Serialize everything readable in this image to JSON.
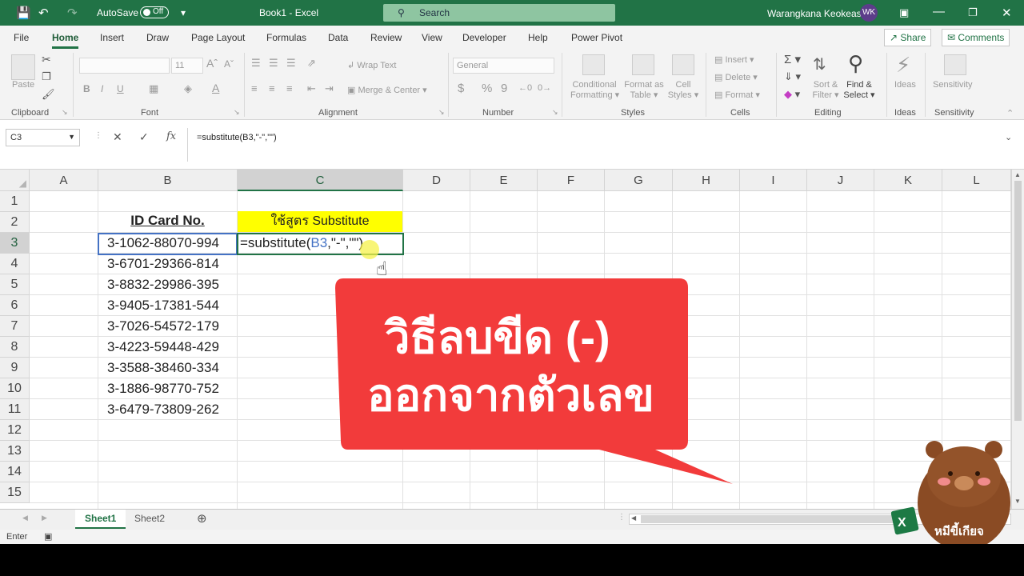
{
  "titlebar": {
    "autosave_label": "AutoSave",
    "autosave_state": "Off",
    "doc_title": "Book1 - Excel",
    "search_placeholder": "Search",
    "user_name": "Warangkana Keokeas",
    "user_initials": "WK"
  },
  "tabs": [
    "File",
    "Home",
    "Insert",
    "Draw",
    "Page Layout",
    "Formulas",
    "Data",
    "Review",
    "View",
    "Developer",
    "Help",
    "Power Pivot"
  ],
  "share_label": "Share",
  "comments_label": "Comments",
  "ribbon": {
    "clipboard": {
      "label": "Clipboard",
      "paste": "Paste"
    },
    "font": {
      "label": "Font",
      "size": "11",
      "bold": "B",
      "italic": "I",
      "underline": "U"
    },
    "alignment": {
      "label": "Alignment",
      "wrap_text": "Wrap Text",
      "merge_center": "Merge & Center"
    },
    "number": {
      "label": "Number",
      "format": "General",
      "currency": "$",
      "percent": "%",
      "comma": "9"
    },
    "styles": {
      "label": "Styles",
      "cond_fmt_1": "Conditional",
      "cond_fmt_2": "Formatting",
      "format_table_1": "Format as",
      "format_table_2": "Table",
      "cell_styles_1": "Cell",
      "cell_styles_2": "Styles"
    },
    "cells": {
      "label": "Cells",
      "insert": "Insert",
      "delete": "Delete",
      "format": "Format"
    },
    "editing": {
      "label": "Editing",
      "sort_1": "Sort &",
      "sort_2": "Filter",
      "find_1": "Find &",
      "find_2": "Select"
    },
    "ideas": {
      "label": "Ideas",
      "btn": "Ideas"
    },
    "sensitivity": {
      "label": "Sensitivity",
      "btn": "Sensitivity"
    }
  },
  "formula_bar": {
    "name_box": "C3",
    "formula": "=substitute(B3,\"-\",\"\")",
    "fx": "fx"
  },
  "grid": {
    "columns": [
      "A",
      "B",
      "C",
      "D",
      "E",
      "F",
      "G",
      "H",
      "I",
      "J",
      "K",
      "L"
    ],
    "rows": [
      "1",
      "2",
      "3",
      "4",
      "5",
      "6",
      "7",
      "8",
      "9",
      "10",
      "11",
      "12",
      "13",
      "14",
      "15"
    ],
    "b2_header": "ID Card No.",
    "c2_header": "ใช้สูตร Substitute",
    "id_values": [
      "3-1062-88070-994",
      "3-6701-29366-814",
      "3-8832-29986-395",
      "3-9405-17381-544",
      "3-7026-54572-179",
      "3-4223-59448-429",
      "3-3588-38460-334",
      "3-1886-98770-752",
      "3-6479-73809-262"
    ],
    "c3_formula_part1": "=substitute(",
    "c3_formula_ref": "B3",
    "c3_formula_part2": ",\"-\",\"\")"
  },
  "sheets": [
    "Sheet1",
    "Sheet2"
  ],
  "status": {
    "mode": "Enter"
  },
  "overlay": {
    "line1": "วิธีลบขีด (-)",
    "line2": "ออกจากตัวเลข",
    "bubble_color": "#f23b3b"
  },
  "mascot": {
    "label": "หมีขี้เกียจ"
  },
  "colors": {
    "excel_green": "#217346",
    "highlight_yellow": "#ffff00",
    "ref_blue": "#4472c4"
  }
}
